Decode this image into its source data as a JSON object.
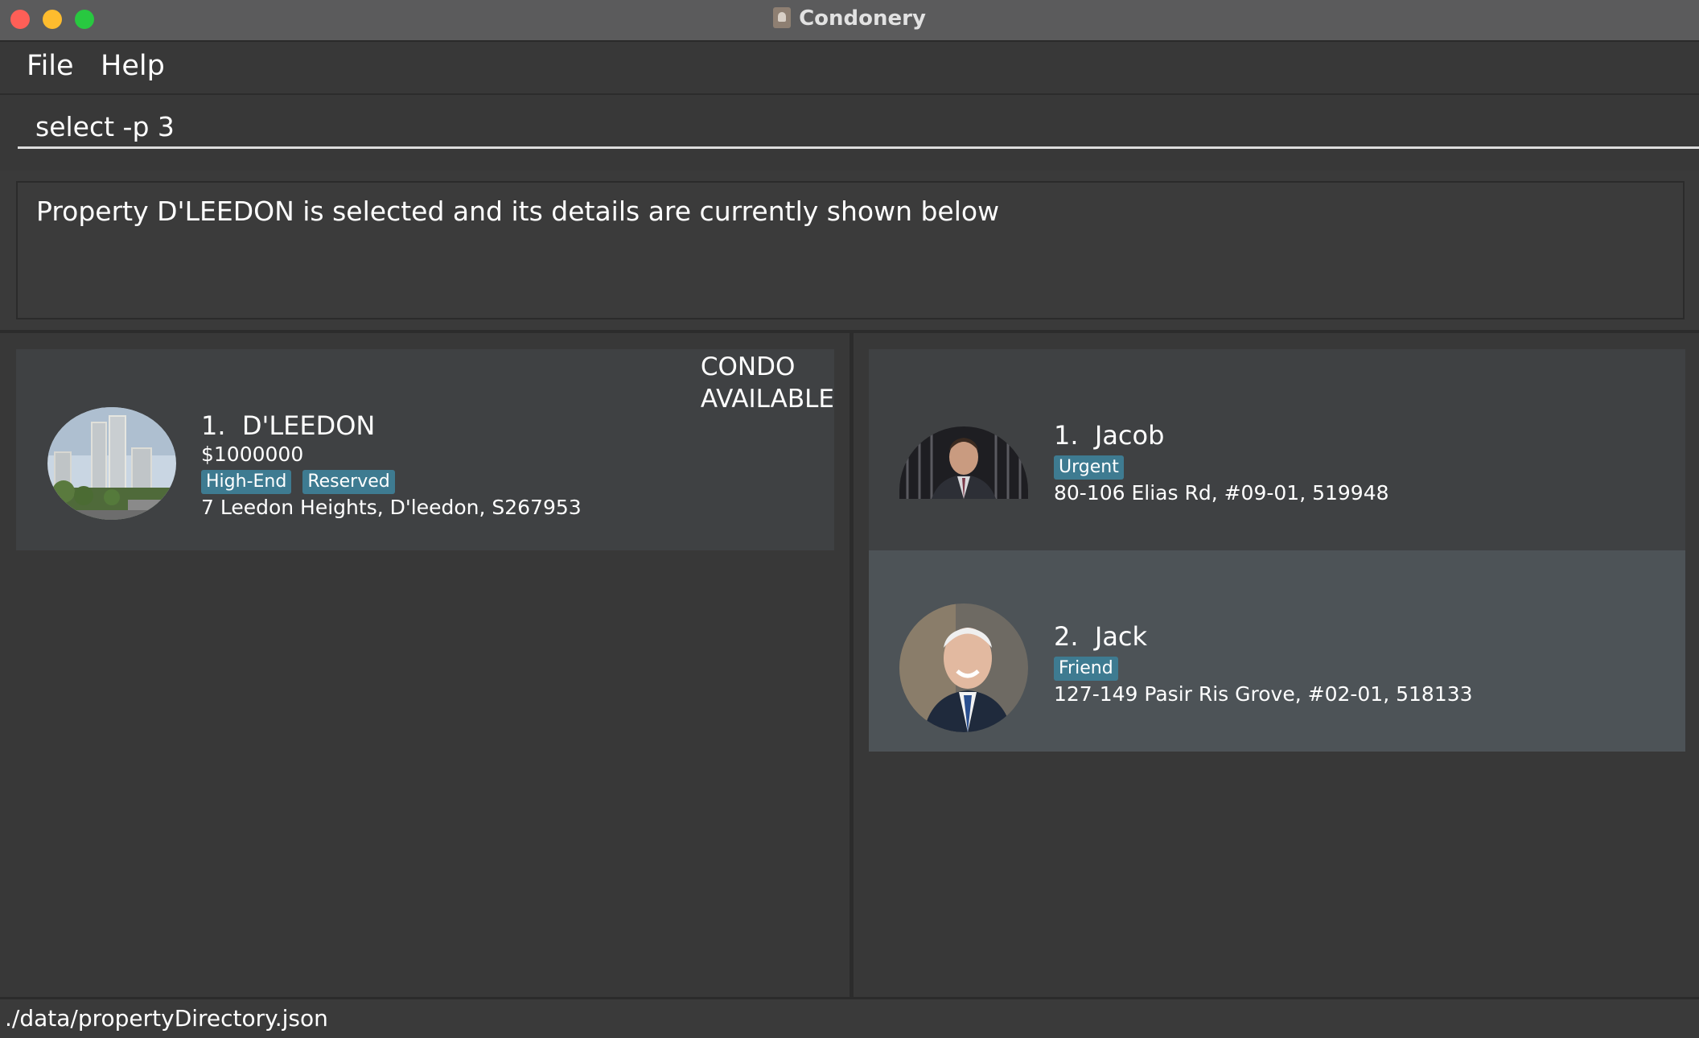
{
  "window": {
    "title": "Condonery"
  },
  "menu": {
    "items": [
      "File",
      "Help"
    ]
  },
  "command": {
    "value": "select -p 3"
  },
  "result": {
    "message": "Property D'LEEDON is selected and its details are currently shown below"
  },
  "properties": [
    {
      "index": "1.",
      "name": "D'LEEDON",
      "price": "$1000000",
      "tags": [
        "High-End",
        "Reserved"
      ],
      "address": "7 Leedon Heights, D'leedon, S267953",
      "type_line1": "CONDO",
      "type_line2": "AVAILABLE"
    }
  ],
  "clients": [
    {
      "index": "1.",
      "name": "Jacob",
      "tags": [
        "Urgent"
      ],
      "address": "80-106 Elias Rd, #09-01, 519948"
    },
    {
      "index": "2.",
      "name": "Jack",
      "tags": [
        "Friend"
      ],
      "address": "127-149 Pasir Ris Grove, #02-01, 518133"
    }
  ],
  "status": {
    "path": "./data/propertyDirectory.json"
  },
  "colors": {
    "tag": "#3e7b91",
    "selected_card": "#4d5357",
    "card": "#3f4143",
    "background": "#383838"
  }
}
